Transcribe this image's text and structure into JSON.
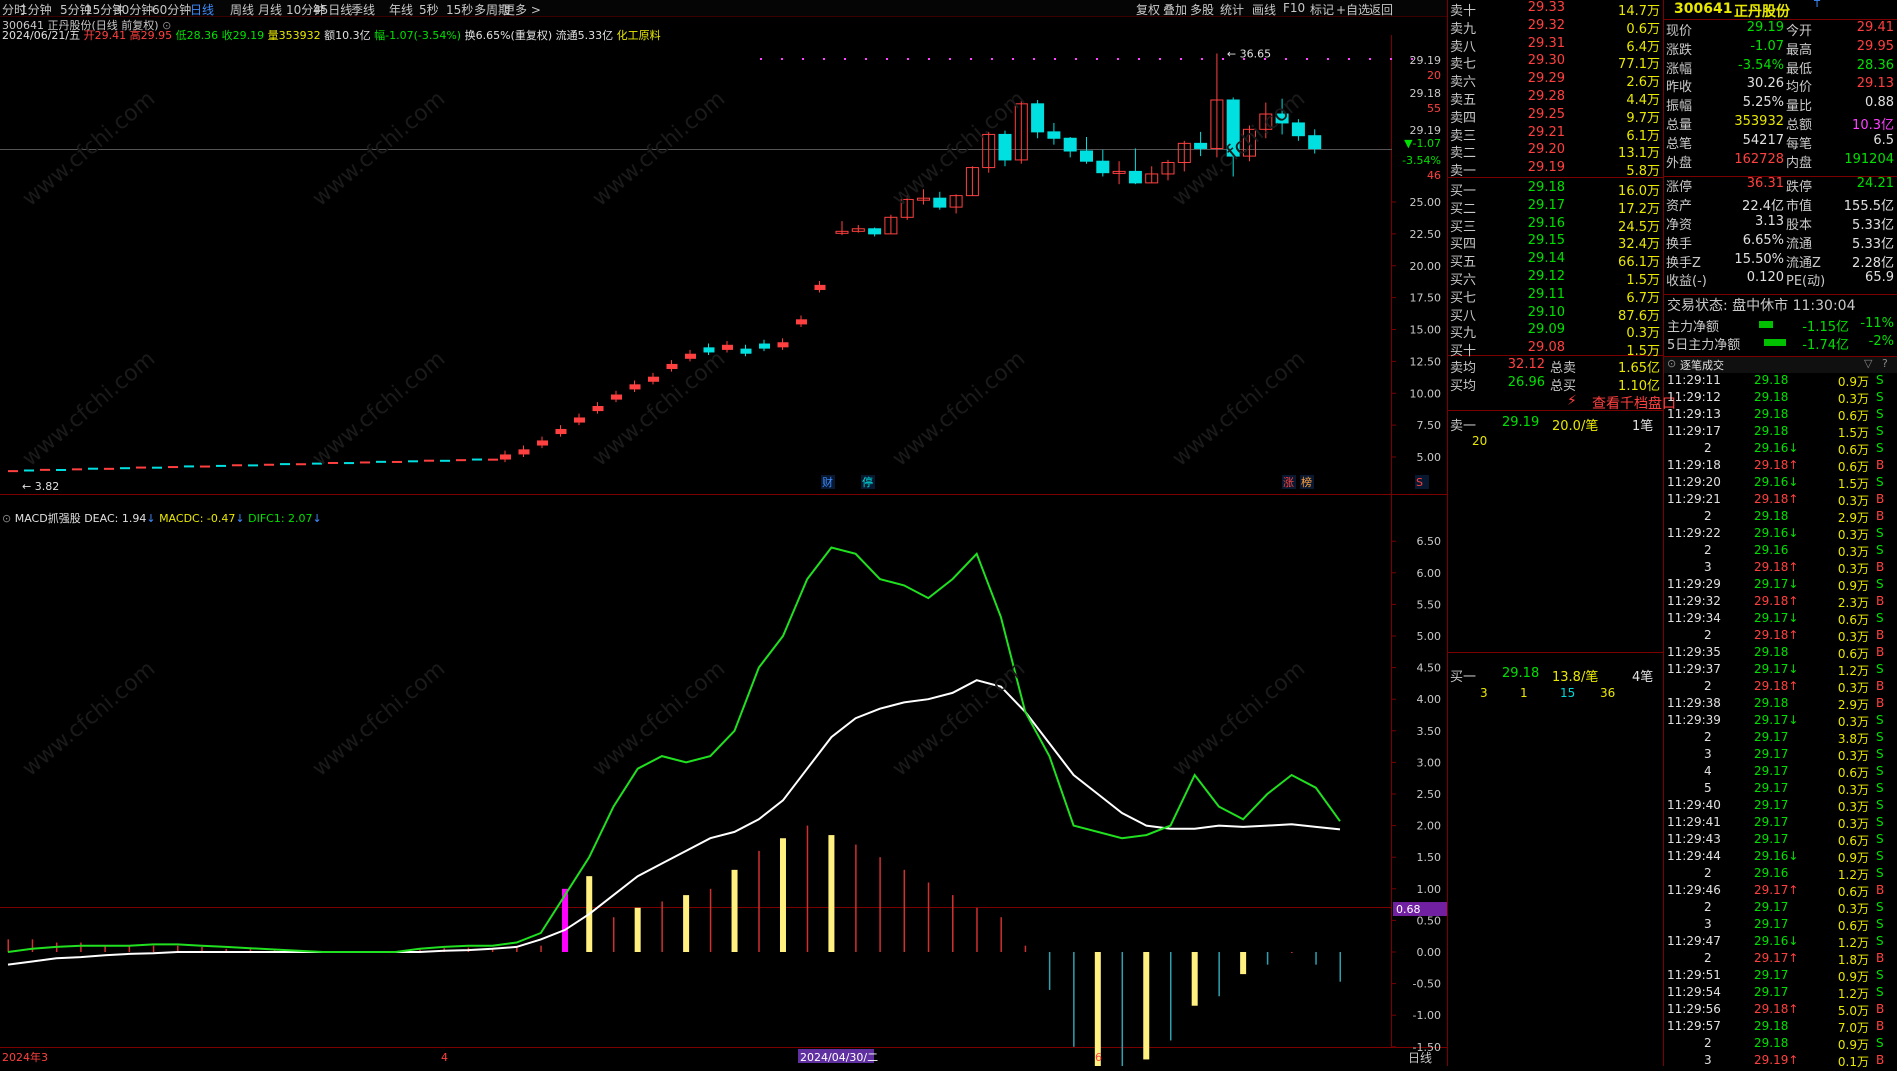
{
  "toolbar": {
    "periods": [
      "分时",
      "1分钟",
      "5分钟",
      "15分钟",
      "30分钟",
      "60分钟",
      "日线",
      "周线",
      "月线",
      "10分钟",
      "45日线",
      "季线",
      "年线",
      "5秒",
      "15秒",
      "多周期",
      "更多"
    ],
    "active": "日线",
    "tools": [
      "复权",
      "叠加",
      "多股",
      "统计",
      "画线",
      "F10",
      "标记",
      "+自选",
      "返回"
    ]
  },
  "chart_header": {
    "title": "300641 正丹股份(日线 前复权)",
    "date": "2024/06/21/五",
    "open": "开29.41",
    "high": "高29.95",
    "low": "低28.36",
    "close": "收29.19",
    "volume": "量353932",
    "amount": "额10.3亿",
    "change": "幅-1.07(-3.54%)",
    "turnover": "换6.65%(重复权)",
    "float_mv": "流通5.33亿",
    "industry": "化工原料"
  },
  "markers": {
    "high_label": "36.65",
    "low_label": "3.82",
    "cai": "财",
    "ting": "停",
    "zhang": "涨",
    "bang": "榜",
    "s_mark": "S"
  },
  "price_axis": {
    "top_labels": [
      "29.19",
      "20",
      "29.18",
      "55",
      "29.19",
      "▼-1.07",
      "-3.54%",
      "46"
    ],
    "labels": [
      "25.00",
      "22.50",
      "20.00",
      "17.50",
      "15.00",
      "12.50",
      "10.00",
      "7.50",
      "5.00"
    ]
  },
  "indicator": {
    "name": "MACD抓强股",
    "deac": "DEAC: 1.94",
    "macdc": "MACDC: -0.47",
    "difc": "DIFC1: 2.07",
    "axis_labels": [
      "6.50",
      "6.00",
      "5.50",
      "5.00",
      "4.50",
      "4.00",
      "3.50",
      "3.00",
      "2.50",
      "2.00",
      "1.50",
      "1.00",
      "0.50",
      "0.00",
      "-0.50",
      "-1.00",
      "-1.50"
    ],
    "current_value": "0.68"
  },
  "date_axis": {
    "labels": [
      "2024年3",
      "4",
      "2024/04/30/二",
      "6"
    ],
    "period_label": "日线"
  },
  "chart_data": {
    "type": "candlestick",
    "candles": [
      [
        22.6,
        23.5,
        22.4,
        22.7
      ],
      [
        22.7,
        23.2,
        22.6,
        22.9
      ],
      [
        22.9,
        23.0,
        22.3,
        22.5
      ],
      [
        22.5,
        24.0,
        22.5,
        23.8
      ],
      [
        23.8,
        25.5,
        23.6,
        25.2
      ],
      [
        25.2,
        26.0,
        24.8,
        25.3
      ],
      [
        25.3,
        25.8,
        24.4,
        24.6
      ],
      [
        24.6,
        25.6,
        24.1,
        25.5
      ],
      [
        25.5,
        27.8,
        25.5,
        27.7
      ],
      [
        27.7,
        30.5,
        27.3,
        30.3
      ],
      [
        30.3,
        30.6,
        27.8,
        28.3
      ],
      [
        28.3,
        32.9,
        28.0,
        32.7
      ],
      [
        32.7,
        33.0,
        30.0,
        30.5
      ],
      [
        30.5,
        31.2,
        29.5,
        30.0
      ],
      [
        30.0,
        30.1,
        28.5,
        29.0
      ],
      [
        29.0,
        30.1,
        28.0,
        28.2
      ],
      [
        28.2,
        29.1,
        27.0,
        27.3
      ],
      [
        27.3,
        28.2,
        26.4,
        27.4
      ],
      [
        27.4,
        29.2,
        26.4,
        26.5
      ],
      [
        26.5,
        27.8,
        26.5,
        27.2
      ],
      [
        27.2,
        28.3,
        26.7,
        28.1
      ],
      [
        28.1,
        29.8,
        27.4,
        29.6
      ],
      [
        29.6,
        30.5,
        28.6,
        29.2
      ],
      [
        29.2,
        36.65,
        28.5,
        33.0
      ],
      [
        33.0,
        33.2,
        27.0,
        28.6
      ],
      [
        28.6,
        31.0,
        28.2,
        30.7
      ],
      [
        30.7,
        32.8,
        30.0,
        31.9
      ],
      [
        31.9,
        33.1,
        30.3,
        31.2
      ],
      [
        31.2,
        31.5,
        29.8,
        30.2
      ],
      [
        30.2,
        30.7,
        28.8,
        29.19
      ]
    ],
    "series": [
      {
        "name": "DIFC1",
        "values": [
          0.0,
          0.05,
          0.08,
          0.1,
          0.1,
          0.1,
          0.12,
          0.12,
          0.1,
          0.08,
          0.06,
          0.04,
          0.02,
          0.0,
          0.0,
          0.0,
          0.0,
          0.05,
          0.08,
          0.1,
          0.1,
          0.15,
          0.3,
          0.9,
          1.5,
          2.3,
          2.9,
          3.1,
          3.0,
          3.1,
          3.5,
          4.5,
          5.0,
          5.9,
          6.4,
          6.3,
          5.9,
          5.8,
          5.6,
          5.9,
          6.3,
          5.3,
          3.8,
          3.1,
          2.0,
          1.9,
          1.8,
          1.85,
          2.0,
          2.8,
          2.3,
          2.1,
          2.5,
          2.8,
          2.6,
          2.07
        ]
      },
      {
        "name": "DEAC",
        "values": [
          -0.2,
          -0.15,
          -0.1,
          -0.08,
          -0.05,
          -0.03,
          -0.02,
          0.0,
          0.0,
          0.0,
          0.0,
          0.0,
          0.0,
          0.0,
          0.0,
          0.0,
          0.0,
          0.0,
          0.02,
          0.03,
          0.05,
          0.08,
          0.2,
          0.35,
          0.6,
          0.9,
          1.2,
          1.4,
          1.6,
          1.8,
          1.9,
          2.1,
          2.4,
          2.9,
          3.4,
          3.7,
          3.85,
          3.95,
          4.0,
          4.1,
          4.3,
          4.2,
          3.8,
          3.3,
          2.8,
          2.5,
          2.2,
          2.0,
          1.95,
          1.95,
          2.0,
          1.98,
          2.0,
          2.02,
          1.98,
          1.94
        ]
      },
      {
        "name": "MACDC",
        "values": [
          0.2,
          0.2,
          0.15,
          0.15,
          0.1,
          0.1,
          0.1,
          0.1,
          0.08,
          0.05,
          0.05,
          0.05,
          0.02,
          0.0,
          0.0,
          0.0,
          0.0,
          0.05,
          0.06,
          0.07,
          0.05,
          0.07,
          0.1,
          1.0,
          1.2,
          0.55,
          0.7,
          0.8,
          0.9,
          1.0,
          1.3,
          1.6,
          1.8,
          2.0,
          1.85,
          1.7,
          1.5,
          1.3,
          1.1,
          0.9,
          0.7,
          0.55,
          0.1,
          -0.6,
          -1.5,
          -2.1,
          -1.95,
          -1.7,
          -1.4,
          -0.85,
          -0.7,
          -0.35,
          -0.2,
          0.0,
          -0.2,
          -0.47
        ]
      }
    ],
    "ylim_price": [
      3.0,
      38.0
    ],
    "ylim_macd": [
      -2.0,
      6.8
    ]
  },
  "quote": {
    "code": "300641",
    "name": "正丹股份",
    "asks": [
      {
        "label": "卖十",
        "price": "29.33",
        "vol": "14.7万"
      },
      {
        "label": "卖九",
        "price": "29.32",
        "vol": "0.6万"
      },
      {
        "label": "卖八",
        "price": "29.31",
        "vol": "6.4万"
      },
      {
        "label": "卖七",
        "price": "29.30",
        "vol": "77.1万"
      },
      {
        "label": "卖六",
        "price": "29.29",
        "vol": "2.6万"
      },
      {
        "label": "卖五",
        "price": "29.28",
        "vol": "4.4万"
      },
      {
        "label": "卖四",
        "price": "29.25",
        "vol": "9.7万"
      },
      {
        "label": "卖三",
        "price": "29.21",
        "vol": "6.1万"
      },
      {
        "label": "卖二",
        "price": "29.20",
        "vol": "13.1万"
      },
      {
        "label": "卖一",
        "price": "29.19",
        "vol": "5.8万"
      }
    ],
    "bids": [
      {
        "label": "买一",
        "price": "29.18",
        "vol": "16.0万"
      },
      {
        "label": "买二",
        "price": "29.17",
        "vol": "17.2万"
      },
      {
        "label": "买三",
        "price": "29.16",
        "vol": "24.5万"
      },
      {
        "label": "买四",
        "price": "29.15",
        "vol": "32.4万"
      },
      {
        "label": "买五",
        "price": "29.14",
        "vol": "66.1万"
      },
      {
        "label": "买六",
        "price": "29.12",
        "vol": "1.5万"
      },
      {
        "label": "买七",
        "price": "29.11",
        "vol": "6.7万"
      },
      {
        "label": "买八",
        "price": "29.10",
        "vol": "87.6万"
      },
      {
        "label": "买九",
        "price": "29.09",
        "vol": "0.3万"
      },
      {
        "label": "买十",
        "price": "29.08",
        "vol": "1.5万"
      }
    ],
    "summary": {
      "ask_avg_label": "卖均",
      "ask_avg": "32.12",
      "total_sell_label": "总卖",
      "total_sell": "1.65亿",
      "bid_avg_label": "买均",
      "bid_avg": "26.96",
      "total_buy_label": "总买",
      "total_buy": "1.10亿"
    },
    "depth_link": "查看千档盘口",
    "sell1": {
      "label": "卖一",
      "price": "29.19",
      "per": "20.0/笔",
      "count": "1笔",
      "queue": [
        "20"
      ]
    },
    "buy1": {
      "label": "买一",
      "price": "29.18",
      "per": "13.8/笔",
      "count": "4笔",
      "queue": [
        "3",
        "1",
        "15",
        "36"
      ]
    }
  },
  "stats": [
    {
      "k1": "现价",
      "v1": "29.19",
      "k2": "今开",
      "v2": "29.41"
    },
    {
      "k1": "涨跌",
      "v1": "-1.07",
      "k2": "最高",
      "v2": "29.95"
    },
    {
      "k1": "涨幅",
      "v1": "-3.54%",
      "k2": "最低",
      "v2": "28.36"
    },
    {
      "k1": "昨收",
      "v1": "30.26",
      "k2": "均价",
      "v2": "29.13"
    },
    {
      "k1": "振幅",
      "v1": "5.25%",
      "k2": "量比",
      "v2": "0.88"
    },
    {
      "k1": "总量",
      "v1": "353932",
      "k2": "总额",
      "v2": "10.3亿"
    },
    {
      "k1": "总笔",
      "v1": "54217",
      "k2": "每笔",
      "v2": "6.5"
    },
    {
      "k1": "外盘",
      "v1": "162728",
      "k2": "内盘",
      "v2": "191204"
    },
    {
      "k1": "涨停",
      "v1": "36.31",
      "k2": "跌停",
      "v2": "24.21"
    },
    {
      "k1": "资产",
      "v1": "22.4亿",
      "k2": "市值",
      "v2": "155.5亿"
    },
    {
      "k1": "净资",
      "v1": "3.13",
      "k2": "股本",
      "v2": "5.33亿"
    },
    {
      "k1": "换手",
      "v1": "6.65%",
      "k2": "流通",
      "v2": "5.33亿"
    },
    {
      "k1": "换手Z",
      "v1": "15.50%",
      "k2": "流通Z",
      "v2": "2.28亿"
    },
    {
      "k1": "收益(-)",
      "v1": "0.120",
      "k2": "PE(动)",
      "v2": "65.9"
    }
  ],
  "trade_status": "交易状态: 盘中休市 11:30:04",
  "fund_flow": [
    {
      "label": "主力净额",
      "value": "-1.15亿",
      "pct": "-11%"
    },
    {
      "label": "5日主力净额",
      "value": "-1.74亿",
      "pct": "-2%"
    }
  ],
  "ticks_header": "逐笔成交",
  "ticks": [
    {
      "t": "11:29:11",
      "p": "29.18",
      "v": "0.9万",
      "s": "S"
    },
    {
      "t": "11:29:12",
      "p": "29.18",
      "v": "0.3万",
      "s": "S"
    },
    {
      "t": "11:29:13",
      "p": "29.18",
      "v": "0.6万",
      "s": "S"
    },
    {
      "t": "11:29:17",
      "p": "29.18",
      "v": "1.5万",
      "s": "S"
    },
    {
      "t": "2",
      "p": "29.16↓",
      "v": "0.6万",
      "s": "S"
    },
    {
      "t": "11:29:18",
      "p": "29.18↑",
      "v": "0.6万",
      "s": "B"
    },
    {
      "t": "11:29:20",
      "p": "29.16↓",
      "v": "1.5万",
      "s": "S"
    },
    {
      "t": "11:29:21",
      "p": "29.18↑",
      "v": "0.3万",
      "s": "B"
    },
    {
      "t": "2",
      "p": "29.18",
      "v": "2.9万",
      "s": "B"
    },
    {
      "t": "11:29:22",
      "p": "29.16↓",
      "v": "0.3万",
      "s": "S"
    },
    {
      "t": "2",
      "p": "29.16",
      "v": "0.3万",
      "s": "S"
    },
    {
      "t": "3",
      "p": "29.18↑",
      "v": "0.3万",
      "s": "B"
    },
    {
      "t": "11:29:29",
      "p": "29.17↓",
      "v": "0.9万",
      "s": "S"
    },
    {
      "t": "11:29:32",
      "p": "29.18↑",
      "v": "2.3万",
      "s": "B"
    },
    {
      "t": "11:29:34",
      "p": "29.17↓",
      "v": "0.6万",
      "s": "S"
    },
    {
      "t": "2",
      "p": "29.18↑",
      "v": "0.3万",
      "s": "B"
    },
    {
      "t": "11:29:35",
      "p": "29.18",
      "v": "0.6万",
      "s": "B"
    },
    {
      "t": "11:29:37",
      "p": "29.17↓",
      "v": "1.2万",
      "s": "S"
    },
    {
      "t": "2",
      "p": "29.18↑",
      "v": "0.3万",
      "s": "B"
    },
    {
      "t": "11:29:38",
      "p": "29.18",
      "v": "2.9万",
      "s": "B"
    },
    {
      "t": "11:29:39",
      "p": "29.17↓",
      "v": "0.3万",
      "s": "S"
    },
    {
      "t": "2",
      "p": "29.17",
      "v": "3.8万",
      "s": "S"
    },
    {
      "t": "3",
      "p": "29.17",
      "v": "0.3万",
      "s": "S"
    },
    {
      "t": "4",
      "p": "29.17",
      "v": "0.6万",
      "s": "S"
    },
    {
      "t": "5",
      "p": "29.17",
      "v": "0.3万",
      "s": "S"
    },
    {
      "t": "11:29:40",
      "p": "29.17",
      "v": "0.3万",
      "s": "S"
    },
    {
      "t": "11:29:41",
      "p": "29.17",
      "v": "0.3万",
      "s": "S"
    },
    {
      "t": "11:29:43",
      "p": "29.17",
      "v": "0.6万",
      "s": "S"
    },
    {
      "t": "11:29:44",
      "p": "29.16↓",
      "v": "0.9万",
      "s": "S"
    },
    {
      "t": "2",
      "p": "29.16",
      "v": "1.2万",
      "s": "S"
    },
    {
      "t": "11:29:46",
      "p": "29.17↑",
      "v": "0.6万",
      "s": "B"
    },
    {
      "t": "2",
      "p": "29.17",
      "v": "0.3万",
      "s": "S"
    },
    {
      "t": "3",
      "p": "29.17",
      "v": "0.6万",
      "s": "S"
    },
    {
      "t": "11:29:47",
      "p": "29.16↓",
      "v": "1.2万",
      "s": "S"
    },
    {
      "t": "2",
      "p": "29.17↑",
      "v": "1.8万",
      "s": "B"
    },
    {
      "t": "11:29:51",
      "p": "29.17",
      "v": "0.9万",
      "s": "S"
    },
    {
      "t": "11:29:54",
      "p": "29.17",
      "v": "1.2万",
      "s": "S"
    },
    {
      "t": "11:29:56",
      "p": "29.18↑",
      "v": "5.0万",
      "s": "B"
    },
    {
      "t": "11:29:57",
      "p": "29.18",
      "v": "7.0万",
      "s": "B"
    },
    {
      "t": "2",
      "p": "29.18",
      "v": "0.9万",
      "s": "S"
    },
    {
      "t": "3",
      "p": "29.19↑",
      "v": "0.1万",
      "s": "B"
    }
  ],
  "watermark": "www.cfchi.com"
}
